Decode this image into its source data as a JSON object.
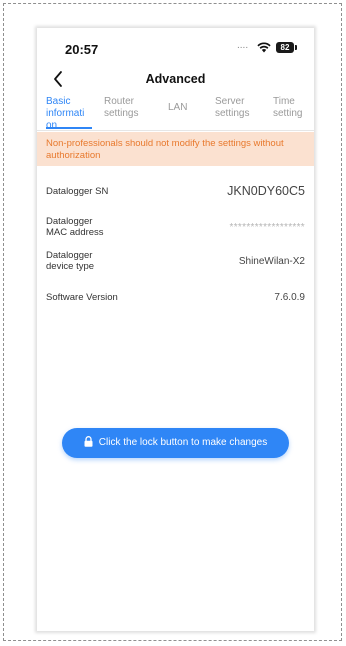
{
  "status_bar": {
    "time": "20:57",
    "signal_dots": "....",
    "battery_level": "82"
  },
  "nav": {
    "title": "Advanced",
    "back_icon": "chevron-left-icon"
  },
  "tabs": [
    {
      "label": "Basic informati on",
      "active": true
    },
    {
      "label": "Router settings",
      "active": false
    },
    {
      "label": "LAN",
      "active": false
    },
    {
      "label": "Server settings",
      "active": false
    },
    {
      "label": "Time setting",
      "active": false
    }
  ],
  "warning": {
    "text": "Non-professionals should not modify the settings without authorization"
  },
  "info_rows": [
    {
      "label": "Datalogger SN",
      "value": "JKN0DY60C5"
    },
    {
      "label": "Datalogger MAC address",
      "value": "******************"
    },
    {
      "label": "Datalogger device type",
      "value": "ShineWilan-X2"
    },
    {
      "label": "Software Version",
      "value": "7.6.0.9"
    }
  ],
  "lock_button": {
    "label": "Click the lock button to make changes",
    "icon": "lock-icon"
  },
  "colors": {
    "accent": "#2f86f6",
    "warning_text": "#e8792d",
    "warning_bg": "#fbe1d0"
  }
}
